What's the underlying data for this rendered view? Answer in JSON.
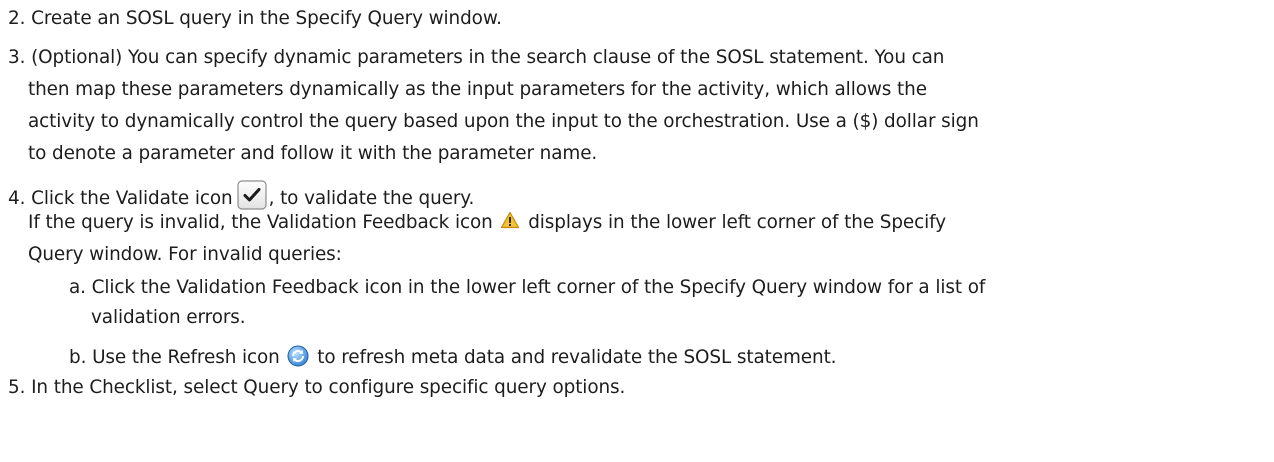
{
  "steps": {
    "s2": "2. Create an SOSL query in the Specify Query window.",
    "s3_l1": "3. (Optional) You can specify dynamic parameters in the search clause of the SOSL statement. You can",
    "s3_l2": "then map these parameters dynamically as the input parameters for the activity, which allows the",
    "s3_l3": "activity to dynamically control the query based upon the input to the orchestration. Use a ($) dollar sign",
    "s3_l4": "to denote a parameter and follow it with the parameter name.",
    "s4_pre": "4. Click the Validate icon",
    "s4_post": ", to validate the query.",
    "s4_l2_pre": "If the query is invalid, the Validation Feedback icon",
    "s4_l2_post": "displays in the lower left corner of the Specify",
    "s4_l3": "Query window. For invalid queries:",
    "sa_l1": "a. Click the Validation Feedback icon in the lower left corner of the Specify Query window for a list of",
    "sa_l2": "validation errors.",
    "sb_pre": "b. Use the Refresh icon",
    "sb_post": "to refresh meta data and revalidate the SOSL statement.",
    "s5": "5. In the Checklist, select Query to configure specific query options."
  },
  "icons": {
    "validate": "checkmark-icon",
    "validation_feedback": "warning-triangle-icon",
    "refresh": "refresh-icon"
  },
  "colors": {
    "text": "#1d1d1d",
    "warning": "#f0b400",
    "refresh": "#2f7fd6"
  }
}
